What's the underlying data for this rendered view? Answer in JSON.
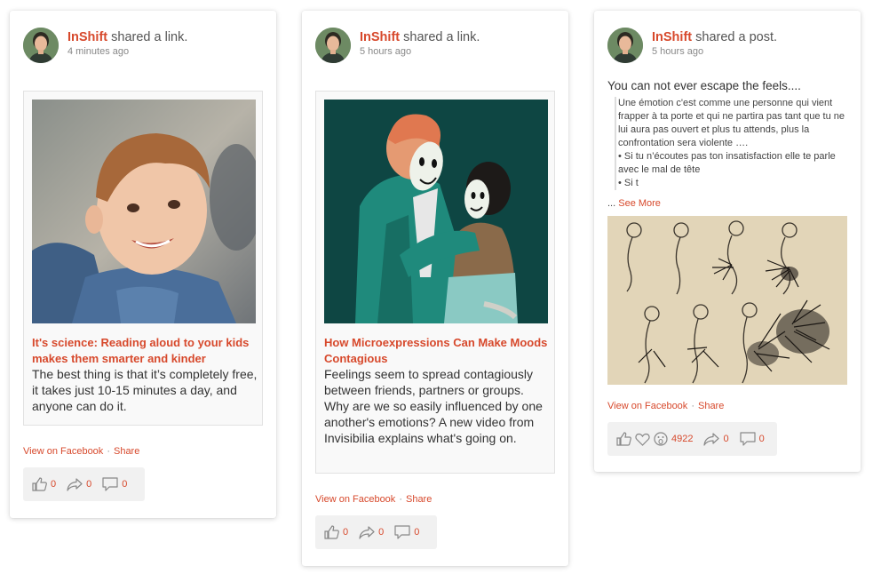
{
  "posts": [
    {
      "author": "InShift",
      "action": "shared a link.",
      "time": "4 minutes ago",
      "link_title": "It's science: Reading aloud to your kids makes them smarter and kinder",
      "link_desc": "The best thing is that it’s completely free, it takes just 10-15 minutes a day, and anyone can do it.",
      "view_label": "View on Facebook",
      "share_label": "Share",
      "likes": "0",
      "shares": "0",
      "comments": "0"
    },
    {
      "author": "InShift",
      "action": "shared a link.",
      "time": "5 hours ago",
      "link_title": "How Microexpressions Can Make Moods Contagious",
      "link_desc": "Feelings seem to spread contagiously between friends, partners or groups. Why are we so easily influenced by one another's emotions? A new video from Invisibilia explains what's going on.",
      "view_label": "View on Facebook",
      "share_label": "Share",
      "likes": "0",
      "shares": "0",
      "comments": "0"
    },
    {
      "author": "InShift",
      "action": "shared a post.",
      "time": "5 hours ago",
      "text": "You can not ever escape the feels....",
      "quote_lines": [
        "Une émotion c'est comme une personne qui vient frapper à ta porte et qui ne partira pas tant que tu ne lui aura pas ouvert et plus tu attends, plus la confrontation sera violente ….",
        "• Si tu n’écoutes pas ton insatisfaction elle te parle avec le mal de tête",
        "• Si t"
      ],
      "see_more_prefix": "...",
      "see_more_label": "See More",
      "view_label": "View on Facebook",
      "share_label": "Share",
      "reactions": "4922",
      "shares": "0",
      "comments": "0"
    }
  ],
  "separator": "·",
  "colors": {
    "accent": "#d7492c",
    "card_bg": "#ffffff",
    "stats_bg": "#f1f1f1"
  }
}
